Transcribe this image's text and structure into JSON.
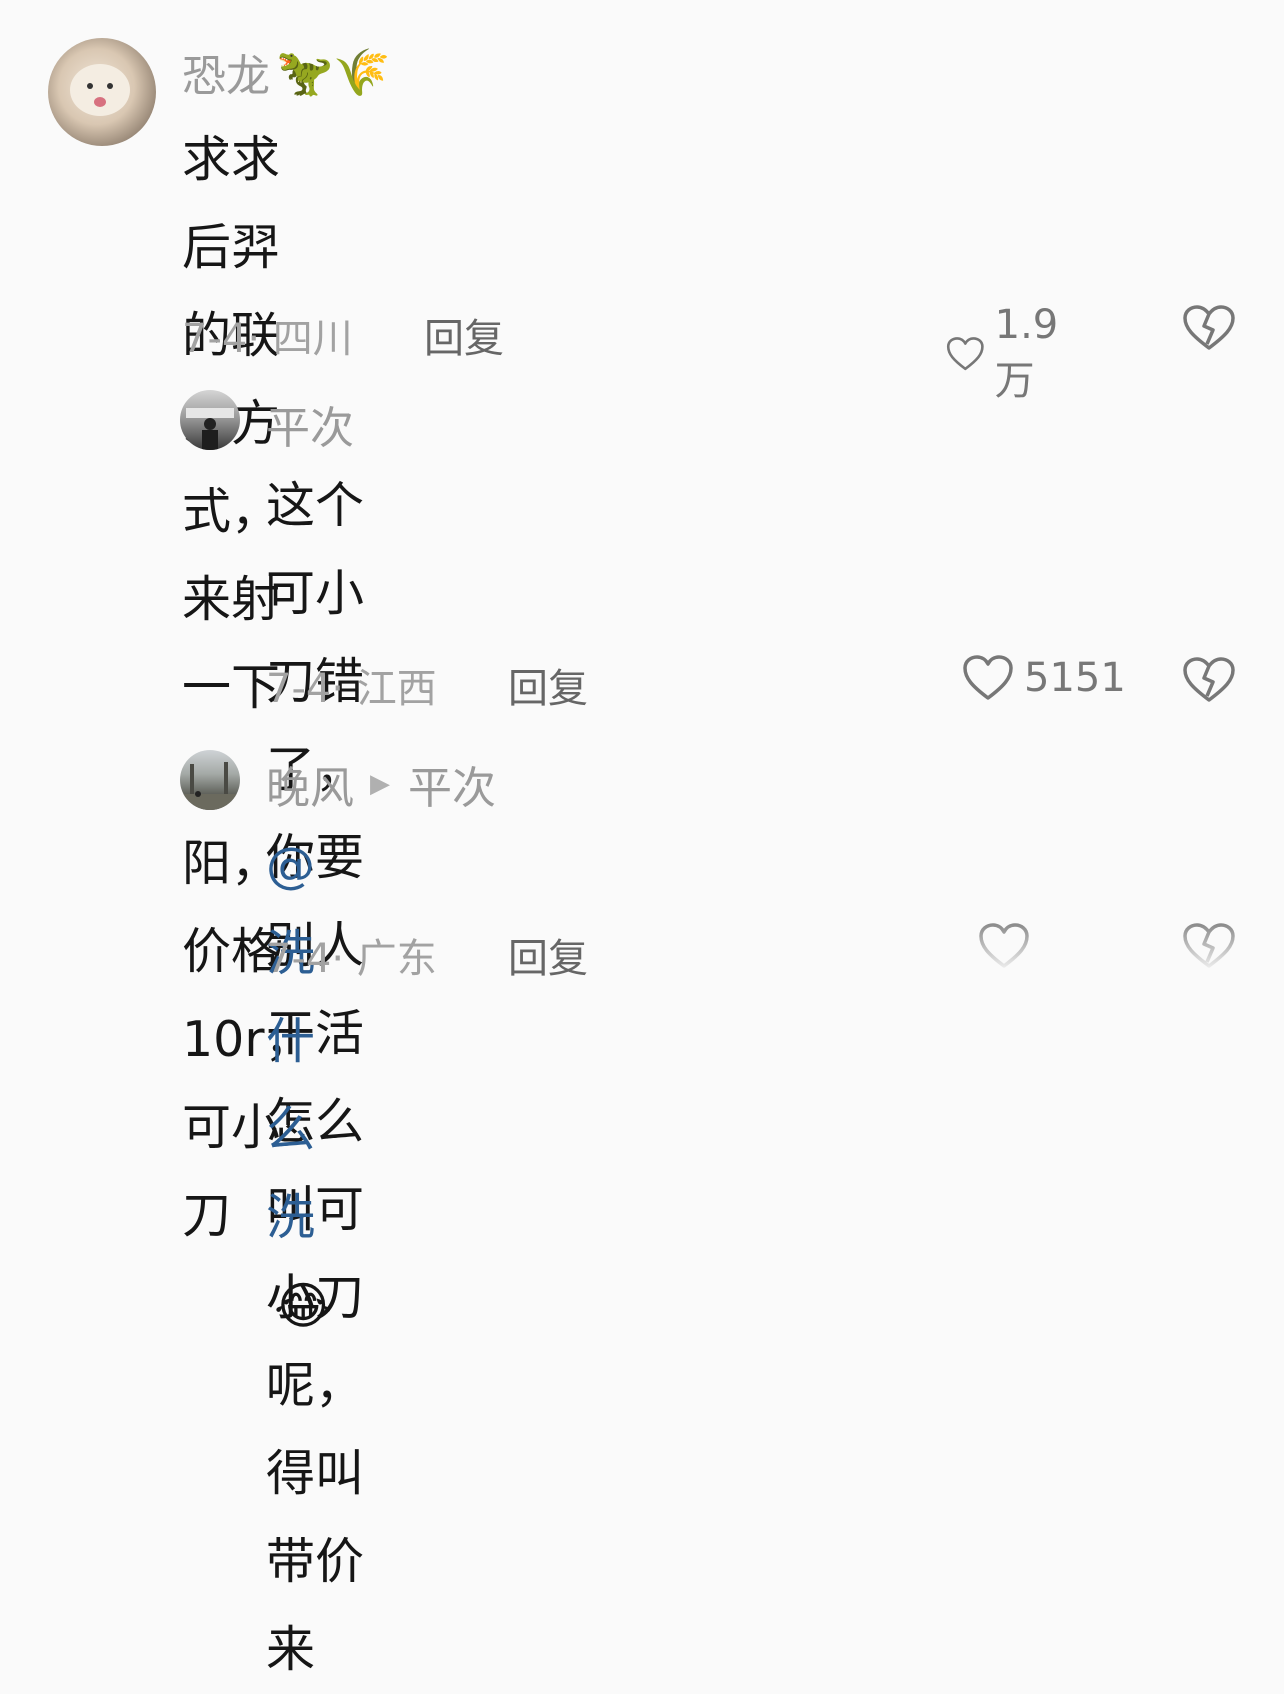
{
  "comments": [
    {
      "username": "恐龙",
      "name_emojis": "🦖🌾",
      "text_line1": "求求后羿的联系方式，来射一下太阳，",
      "text_line2": "价格10r，可小刀",
      "date": "7-4",
      "location": "四川",
      "reply_label": "回复",
      "likes": "1.9万"
    },
    {
      "username": "平次",
      "text_line1": "这个可小刀错了，你要别人干活怎么",
      "text_line2": "叫可小刀呢，得叫带价来",
      "date": "7-4",
      "location": "江西",
      "reply_label": "回复",
      "likes": "5151"
    },
    {
      "username": "晚风",
      "reply_to": "平次",
      "mention": "@洗什么洗",
      "emoji": "😂",
      "date": "7-4",
      "location": "广东",
      "reply_label": "回复"
    }
  ],
  "colors": {
    "background": "#fafafa",
    "username": "#9a9a9a",
    "mention": "#2c5e93",
    "meta": "#a2a2a2"
  },
  "icons": [
    "heart-icon",
    "broken-heart-icon",
    "play-arrow-icon"
  ]
}
